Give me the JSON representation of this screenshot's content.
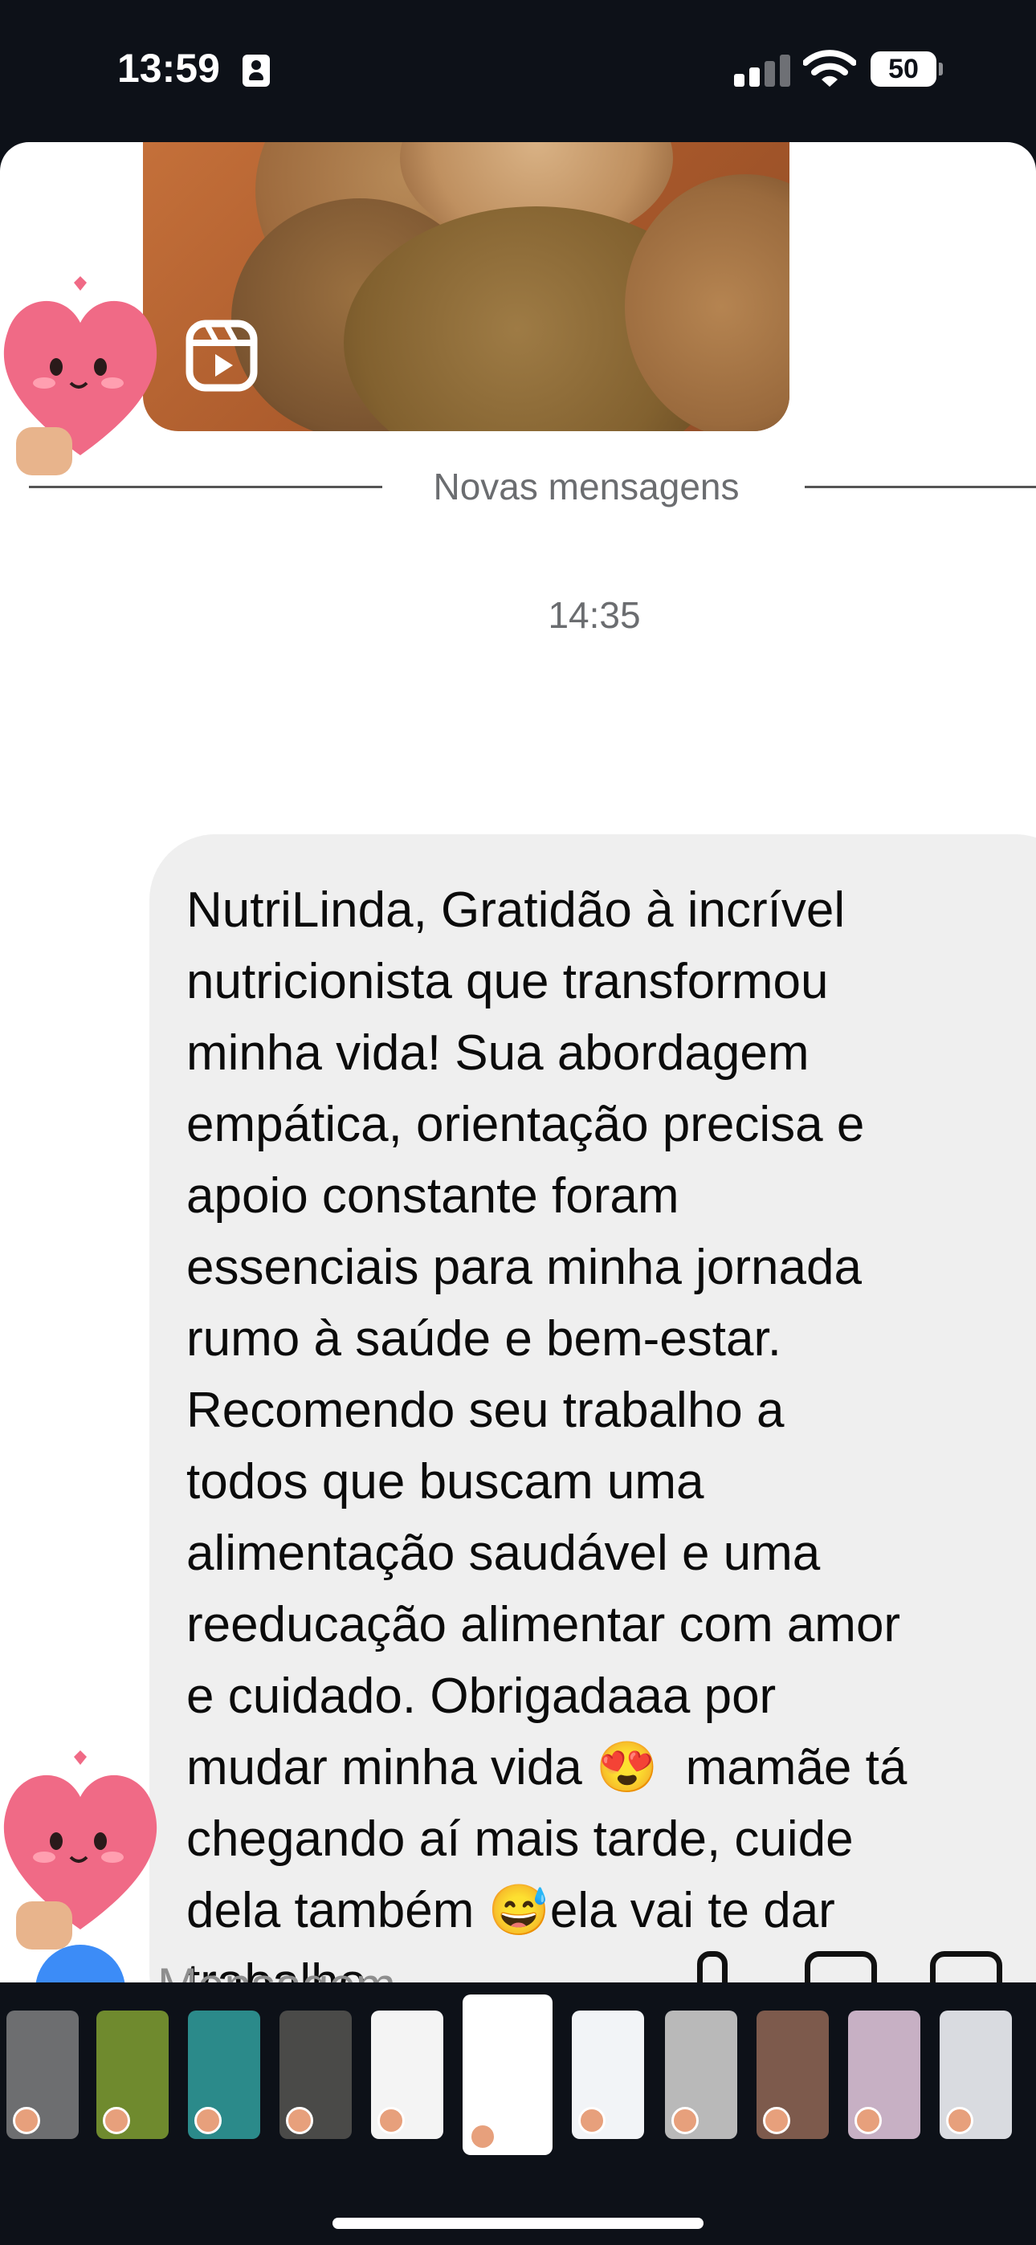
{
  "status_bar": {
    "time": "13:59",
    "battery": "50",
    "icons": [
      "id-card-icon",
      "signal-icon",
      "wifi-icon",
      "battery-icon"
    ]
  },
  "chat": {
    "shared_reel_icon": "reel-icon",
    "divider_label": "Novas mensagens",
    "timestamp": "14:35",
    "message": "NutriLinda, Gratidão à incrível\nnutricionista que transformou\nminha vida! Sua abordagem\nempática, orientação precisa e\napoio constante foram\nessenciais para minha jornada\nrumo à saúde e bem-estar.\nRecomendo seu trabalho a\ntodos que buscam uma\nalimentação saudável e uma\nreeducação alimentar com amor\ne cuidado. Obrigadaaa por\nmudar minha vida 😍  mamãe tá\nchegando aí mais tarde, cuide\ndela também 😅ela vai te dar\ntrabalho",
    "reaction_sticker": "heart-character-sticker"
  },
  "composer": {
    "placeholder": "Mensagem"
  },
  "story_tray": {
    "thumbnails": [
      {
        "color": "#6d6e70"
      },
      {
        "color": "#6f8a2e"
      },
      {
        "color": "#2b8a8a"
      },
      {
        "color": "#4a4a48"
      },
      {
        "color": "#f4f4f4"
      },
      {
        "color": "#ffffff"
      },
      {
        "color": "#f2f4f7"
      },
      {
        "color": "#b9b9b9"
      },
      {
        "color": "#7d5a4c"
      },
      {
        "color": "#c7b0c4"
      },
      {
        "color": "#d9dbe0"
      }
    ]
  },
  "colors": {
    "background": "#0d1118",
    "bubble": "#efefef",
    "accent": "#3c8cf7"
  }
}
